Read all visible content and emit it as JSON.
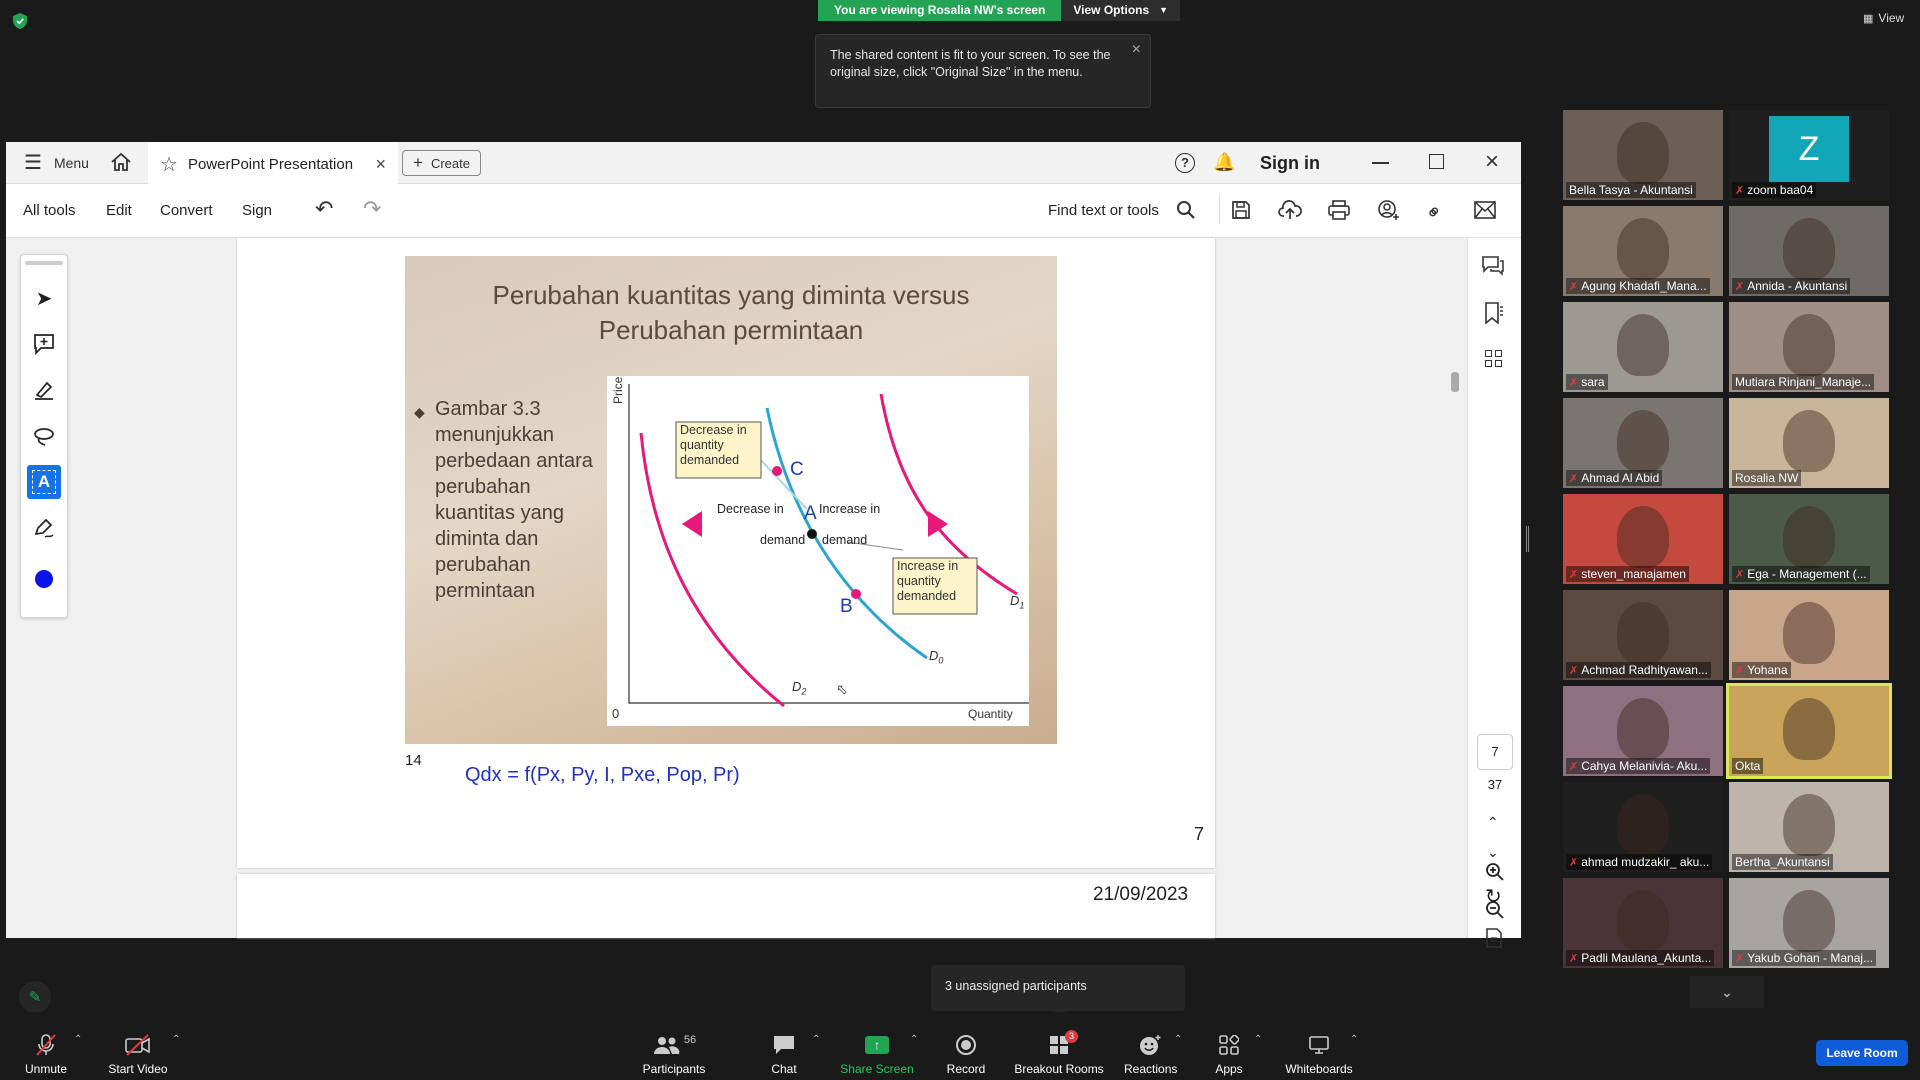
{
  "share": {
    "banner_text": "You are viewing Rosalia NW's screen",
    "view_options": "View Options",
    "tooltip": "The shared content is fit to your screen. To see the original size, click \"Original Size\" in the menu.",
    "view_label": "View"
  },
  "acrobat": {
    "menu": "Menu",
    "tab_title": "PowerPoint Presentation",
    "create": "Create",
    "sign_in": "Sign in",
    "toolbar": {
      "all_tools": "All tools",
      "edit": "Edit",
      "convert": "Convert",
      "sign": "Sign",
      "find": "Find text or tools"
    },
    "page_current": "7",
    "page_total": "37",
    "page_number": "7",
    "next_page_date": "21/09/2023",
    "slide": {
      "title_line1": "Perubahan kuantitas yang diminta versus",
      "title_line2": "Perubahan permintaan",
      "bullet": "Gambar 3.3 menunjukkan perbedaan antara perubahan kuantitas yang diminta dan perubahan permintaan",
      "slide_number": "14",
      "formula": "Qdx = f(Px, Py, I, Pxe, Pop, Pr)"
    },
    "chart": {
      "ylabel": "Price",
      "xlabel": "Quantity",
      "origin": "0",
      "box_decrease": "Decrease in quantity demanded",
      "box_increase": "Increase in quantity demanded",
      "decrease_in": "Decrease in",
      "increase_in": "Increase in",
      "demand_left": "demand",
      "demand_right": "demand",
      "point_a": "A",
      "point_b": "B",
      "point_c": "C",
      "d0": "D",
      "d0_sub": "0",
      "d1": "D",
      "d1_sub": "1",
      "d2": "D",
      "d2_sub": "2",
      "colors": {
        "d0": "#2ba5cf",
        "shift": "#e8177a"
      }
    }
  },
  "participants": [
    {
      "name": "Bella Tasya - Akuntansi",
      "muted": false,
      "bg": "#6b5f58"
    },
    {
      "name": "zoom baa04",
      "muted": true,
      "bg": "#1f1f1f",
      "avatar": "Z"
    },
    {
      "name": "Agung Khadafi_Mana...",
      "muted": true,
      "bg": "#8a7a6e"
    },
    {
      "name": "Annida - Akuntansi",
      "muted": true,
      "bg": "#6e6a66"
    },
    {
      "name": "sara",
      "muted": true,
      "bg": "#9c9892"
    },
    {
      "name": "Mutiara Rinjani_Manaje...",
      "muted": false,
      "bg": "#a08e86"
    },
    {
      "name": "Ahmad Al Abid",
      "muted": true,
      "bg": "#7a7570"
    },
    {
      "name": "Rosalia NW",
      "muted": false,
      "bg": "#c9b59a"
    },
    {
      "name": "steven_manajamen",
      "muted": true,
      "bg": "#c4493f"
    },
    {
      "name": "Ega - Management (...",
      "muted": true,
      "bg": "#4c5a4a"
    },
    {
      "name": "Achmad Radhityawan...",
      "muted": true,
      "bg": "#5c4a40"
    },
    {
      "name": "Yohana",
      "muted": true,
      "bg": "#c9a58a"
    },
    {
      "name": "Cahya Melanivia- Aku...",
      "muted": true,
      "bg": "#8e7080"
    },
    {
      "name": "Okta",
      "muted": false,
      "bg": "#c9a45a",
      "active": true
    },
    {
      "name": "ahmad mudzakir_ aku...",
      "muted": true,
      "bg": "#1f1f1f"
    },
    {
      "name": "Bertha_Akuntansi",
      "muted": false,
      "bg": "#bdb4ac"
    },
    {
      "name": "Padli Maulana_Akunta...",
      "muted": true,
      "bg": "#4a3438"
    },
    {
      "name": "Yakub Gohan - Manaj...",
      "muted": true,
      "bg": "#a8a4a2"
    }
  ],
  "unassigned_popup": "3 unassigned participants",
  "bottom_bar": {
    "unmute": "Unmute",
    "start_video": "Start Video",
    "participants": "Participants",
    "participants_count": "56",
    "chat": "Chat",
    "share_screen": "Share Screen",
    "record": "Record",
    "breakout_rooms": "Breakout Rooms",
    "breakout_badge": "3",
    "reactions": "Reactions",
    "apps": "Apps",
    "whiteboards": "Whiteboards",
    "leave_room": "Leave Room"
  }
}
